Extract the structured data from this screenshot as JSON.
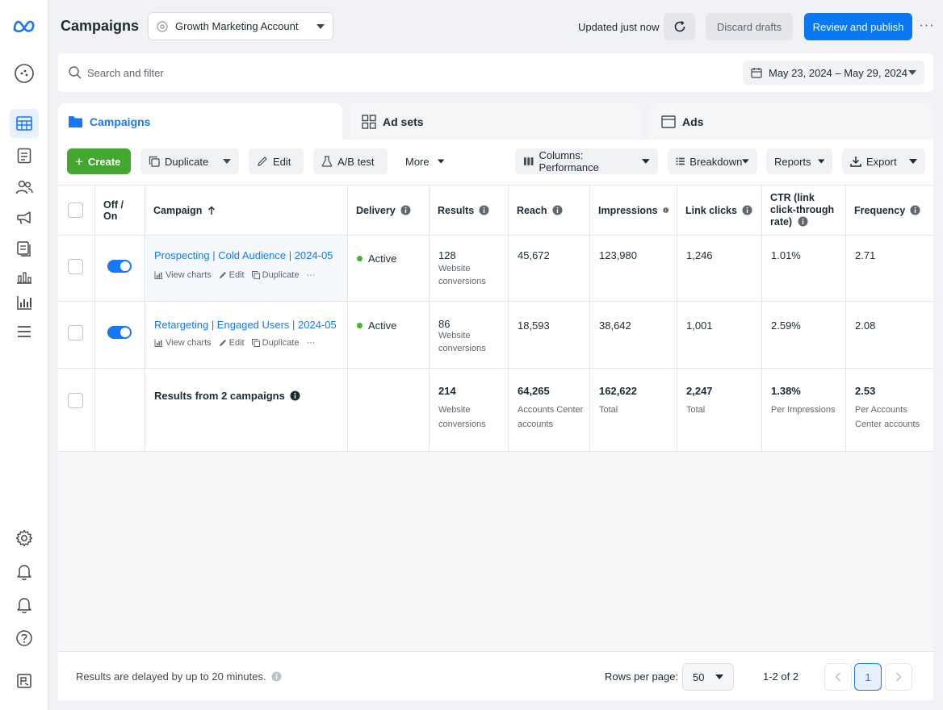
{
  "header": {
    "title": "Campaigns",
    "account": "Growth Marketing Account",
    "updated": "Updated just now",
    "discard_label": "Discard drafts",
    "publish_label": "Review and publish"
  },
  "search": {
    "placeholder": "Search and filter",
    "date_range": "May 23, 2024 – May 29, 2024"
  },
  "tabs": [
    {
      "label": "Campaigns"
    },
    {
      "label": "Ad sets"
    },
    {
      "label": "Ads"
    }
  ],
  "toolbar": {
    "create": "Create",
    "duplicate": "Duplicate",
    "edit": "Edit",
    "ab_test": "A/B test",
    "more": "More",
    "columns": "Columns: Performance",
    "breakdown": "Breakdown",
    "reports": "Reports",
    "export": "Export"
  },
  "table": {
    "headers": {
      "onoff": "Off / On",
      "campaign": "Campaign",
      "delivery": "Delivery",
      "results": "Results",
      "reach": "Reach",
      "impressions": "Impressions",
      "link_clicks": "Link clicks",
      "ctr": "CTR (link click-through rate)",
      "frequency": "Frequency"
    },
    "row_actions": {
      "view_charts": "View charts",
      "edit": "Edit",
      "duplicate": "Duplicate",
      "more": "···"
    },
    "rows": [
      {
        "name": "Prospecting | Cold Audience | 2024-05",
        "delivery": "Active",
        "results": "128",
        "results_sub": "Website conversions",
        "reach": "45,672",
        "impressions": "123,980",
        "link_clicks": "1,246",
        "ctr": "1.01%",
        "frequency": "2.71"
      },
      {
        "name": "Retargeting | Engaged Users | 2024-05",
        "delivery": "Active",
        "results": "86",
        "results_sub": "Website conversions",
        "reach": "18,593",
        "impressions": "38,642",
        "link_clicks": "1,001",
        "ctr": "2.59%",
        "frequency": "2.08"
      }
    ],
    "totals": {
      "label": "Results from 2 campaigns",
      "results": "214",
      "results_sub": "Website conversions",
      "reach": "64,265",
      "reach_sub": "Accounts Center accounts",
      "impressions": "162,622",
      "impressions_sub": "Total",
      "link_clicks": "2,247",
      "link_clicks_sub": "Total",
      "ctr": "1.38%",
      "ctr_sub": "Per Impressions",
      "frequency": "2.53",
      "frequency_sub": "Per Accounts Center accounts"
    }
  },
  "footer": {
    "note": "Results are delayed by up to 20 minutes.",
    "rows_label": "Rows per page:",
    "rows_value": "50",
    "range": "1-2 of 2",
    "page": "1"
  },
  "colors": {
    "accent": "#1877f2",
    "create": "#42a82e",
    "active_dot": "#42b72a"
  }
}
